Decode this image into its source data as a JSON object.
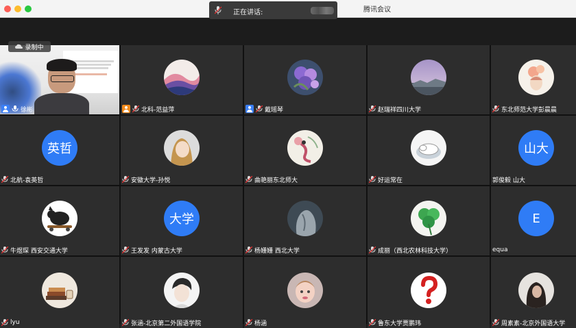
{
  "app_title": "腾讯会议",
  "speaking_label": "正在讲话:",
  "recording_label": "录制中",
  "colors": {
    "avatar_blue": "#2f7cf6",
    "host_blue": "#3b7ff5",
    "host_orange": "#f0891a"
  },
  "participants": [
    {
      "name": "徐彬",
      "type": "video",
      "host": "blue"
    },
    {
      "name": "北科-范益萍",
      "type": "image",
      "avatar": "abstract-pink-wave",
      "host": "orange"
    },
    {
      "name": "戴瑶琴",
      "type": "image",
      "avatar": "purple-flower",
      "host": "blue"
    },
    {
      "name": "赵瑞祥四川大学",
      "type": "image",
      "avatar": "purple-sky-landscape"
    },
    {
      "name": "东北师范大学彭晨晨",
      "type": "image",
      "avatar": "peach-flower-girl"
    },
    {
      "name": "北航-袁英哲",
      "type": "text",
      "initials": "英哲"
    },
    {
      "name": "安徽大学-孙悦",
      "type": "image",
      "avatar": "anime-girl"
    },
    {
      "name": "曲艳丽东北师大",
      "type": "image",
      "avatar": "dancer-painting"
    },
    {
      "name": "好运常在",
      "type": "image",
      "avatar": "sleeping-cat"
    },
    {
      "name": "郭俊毅 山大",
      "type": "text",
      "initials": "山大"
    },
    {
      "name": "牛煜琛 西安交通大学",
      "type": "image",
      "avatar": "cat-skateboard"
    },
    {
      "name": "王发发 内蒙古大学",
      "type": "text",
      "initials": "大学"
    },
    {
      "name": "杨姗姗 西北大学",
      "type": "image",
      "avatar": "rock-sculpture"
    },
    {
      "name": "成丽（西北农林科技大学）",
      "type": "image",
      "avatar": "clover-leaf"
    },
    {
      "name": "equa",
      "type": "text",
      "initials": "E"
    },
    {
      "name": "lyu",
      "type": "image",
      "avatar": "books-cup"
    },
    {
      "name": "张涵-北京第二外国语学院",
      "type": "image",
      "avatar": "sketch-portrait"
    },
    {
      "name": "杨涵",
      "type": "image",
      "avatar": "child-photo"
    },
    {
      "name": "鲁东大学贾鹏玮",
      "type": "image",
      "avatar": "red-question-mark"
    },
    {
      "name": "周素素-北京外国语大学",
      "type": "image",
      "avatar": "dark-portrait"
    }
  ]
}
